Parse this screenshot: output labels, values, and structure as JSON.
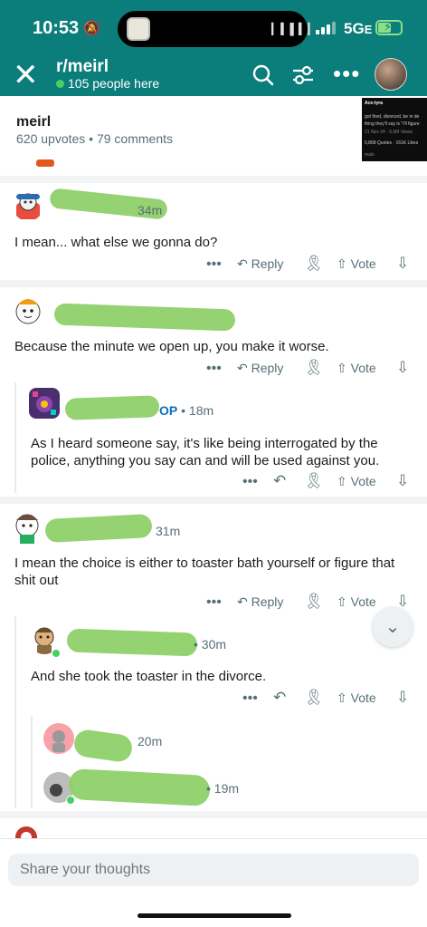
{
  "status_bar": {
    "time": "10:53",
    "network": "5G",
    "network_suffix": "E"
  },
  "header": {
    "subreddit": "r/meirl",
    "online": "105 people here"
  },
  "post": {
    "title": "meirl",
    "meta": "620 upvotes • 79 comments",
    "thumbnail_lines": [
      "Ace-tyra",
      "got fired, divorced, be in de",
      "thing they'll say is \"I'll figure",
      "21 Nov 24 · 5.6M Views",
      "5,868 Quotes · 161K Likes",
      "malo"
    ]
  },
  "comments": [
    {
      "time": "34m",
      "text": "I mean... what else we gonna do?",
      "reply": "Reply",
      "vote": "Vote"
    },
    {
      "time": "",
      "text": "Because the minute we open up, you make it worse.",
      "reply": "Reply",
      "vote": "Vote"
    },
    {
      "badge": "OP",
      "time": "18m",
      "text": "As I heard someone say, it's like being interrogated by the police, anything you say can and will be used against you.",
      "vote": "Vote"
    },
    {
      "time": "31m",
      "text": "I mean the choice is either to toaster bath yourself or figure that shit out",
      "reply": "Reply",
      "vote": "Vote"
    },
    {
      "time": "30m",
      "text": "And she took the toaster in the divorce.",
      "vote": "Vote"
    },
    {
      "time": "20m"
    },
    {
      "time": "19m"
    }
  ],
  "composer": {
    "placeholder": "Share your thoughts"
  },
  "icons": {
    "close": "close-icon",
    "search": "search-icon",
    "filter": "filter-icon",
    "more": "more-icon",
    "reply": "reply-icon",
    "award": "award-icon",
    "upvote": "upvote-icon",
    "downvote": "downvote-icon",
    "chevron": "chevron-down-icon"
  },
  "colors": {
    "brand": "#0b7d7a",
    "online": "#46d160",
    "op": "#0a6fc2",
    "scribble": "#8fd06a"
  }
}
